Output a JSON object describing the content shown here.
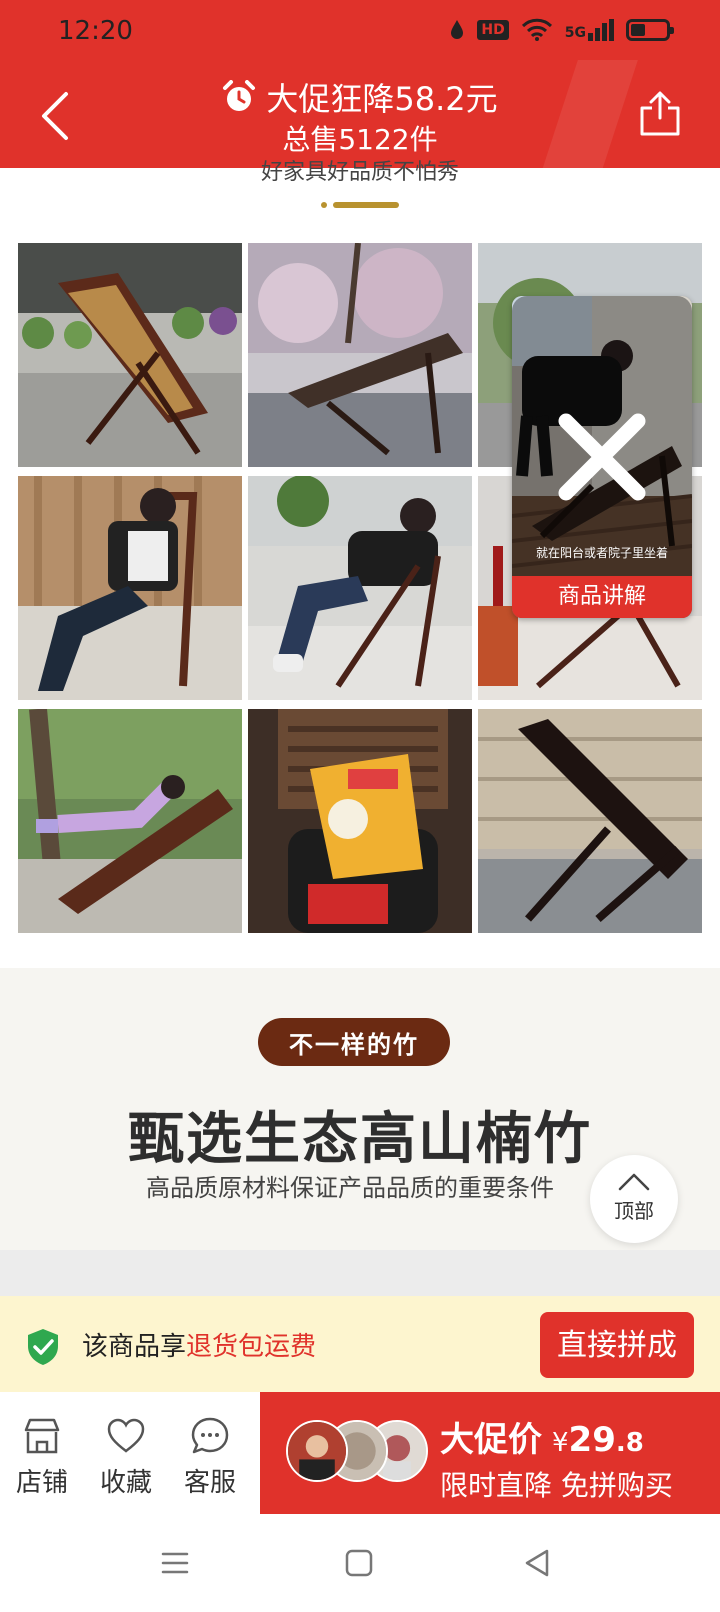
{
  "status_bar": {
    "time": "12:20",
    "hd_badge": "HD",
    "signal_label": "5G"
  },
  "header": {
    "promo_title": "大促狂降58.2元",
    "sales_total": "总售5122件",
    "back_icon": "chevron-left-icon",
    "share_icon": "share-icon",
    "alarm_icon": "alarm-clock-icon"
  },
  "gallery": {
    "section_title": "好家具好品质不怕秀",
    "photos": [
      "chair-on-patio",
      "chair-under-tree",
      "chair-garden",
      "girl-reclining",
      "man-reclining",
      "chair-red-floor",
      "child-reclining",
      "person-reading",
      "chair-balcony"
    ]
  },
  "video": {
    "caption": "就在阳台或者院子里坐着",
    "button_label": "商品讲解"
  },
  "bamboo": {
    "badge": "不一样的竹",
    "headline": "甄选生态高山楠竹",
    "subtitle": "高品质原材料保证产品品质的重要条件"
  },
  "to_top": {
    "label": "顶部"
  },
  "guarantee": {
    "text_prefix": "该商品享",
    "text_highlight": "退货包运费",
    "group_buy_label": "直接拼成"
  },
  "bottom_bar": {
    "store_label": "店铺",
    "favorite_label": "收藏",
    "service_label": "客服",
    "buy_title": "大促价",
    "currency": "¥",
    "price_int": "29",
    "price_dec": ".8",
    "buy_subtitle": "限时直降 免拼购买"
  },
  "colors": {
    "brand_red": "#e0322b",
    "badge_brown": "#6b2a12",
    "guarantee_bg": "#fdf5cf",
    "shield_green": "#2fa84f"
  }
}
